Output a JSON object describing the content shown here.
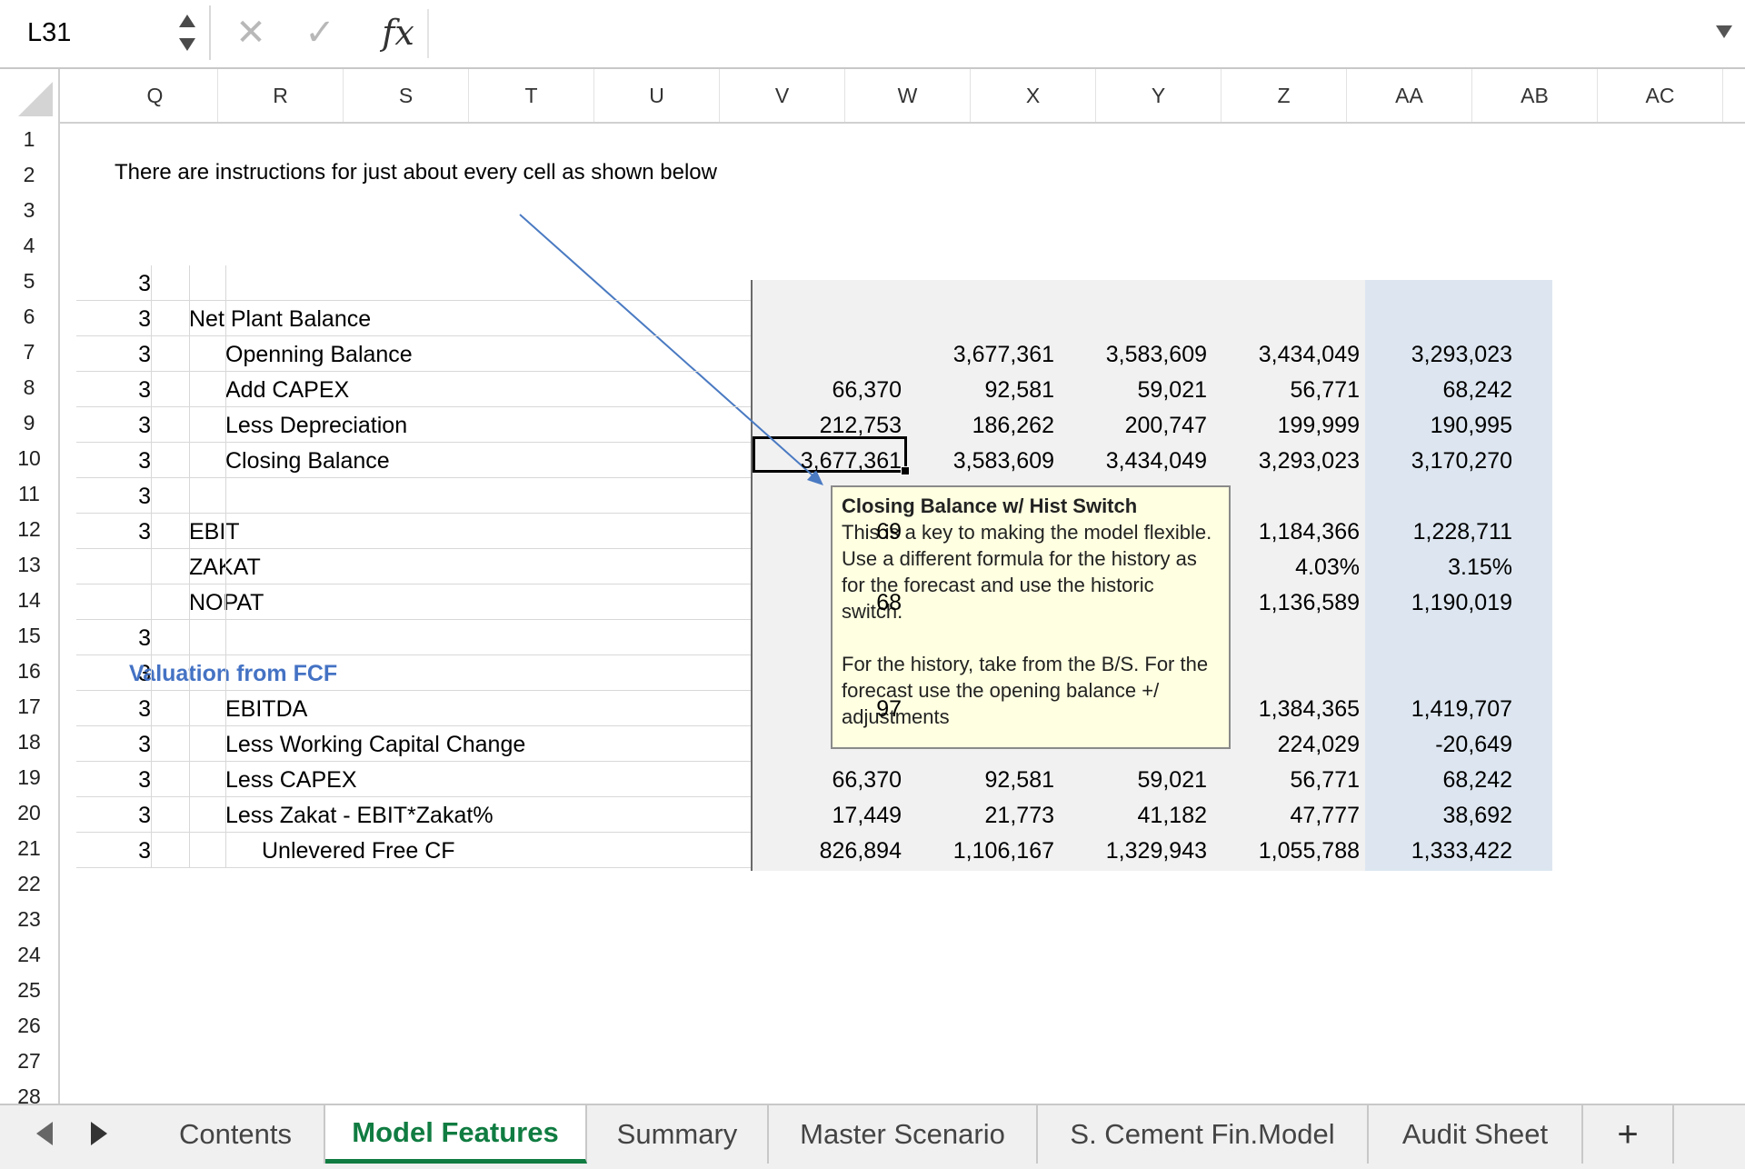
{
  "formula_bar": {
    "name_box": "L31",
    "cancel_glyph": "✕",
    "enter_glyph": "✓",
    "insert_function_glyph": "fx",
    "formula": ""
  },
  "columns": [
    "Q",
    "R",
    "S",
    "T",
    "U",
    "V",
    "W",
    "X",
    "Y",
    "Z",
    "AA",
    "AB",
    "AC"
  ],
  "rows": [
    "1",
    "2",
    "3",
    "4",
    "5",
    "6",
    "7",
    "8",
    "9",
    "10",
    "11",
    "12",
    "13",
    "14",
    "15",
    "16",
    "17",
    "18",
    "19",
    "20",
    "21",
    "22",
    "23",
    "24",
    "25",
    "26",
    "27",
    "28"
  ],
  "note": "There are instructions for just about every cell as shown below",
  "table": {
    "rows": [
      {
        "level": "3",
        "label": "",
        "indent": 0,
        "values": [
          "",
          "",
          "",
          "",
          ""
        ]
      },
      {
        "level": "3",
        "label": "Net Plant Balance",
        "indent": 1,
        "values": [
          "",
          "",
          "",
          "",
          ""
        ]
      },
      {
        "level": "3",
        "label": "Openning Balance",
        "indent": 2,
        "values": [
          "",
          "3,677,361",
          "3,583,609",
          "3,434,049",
          "3,293,023"
        ]
      },
      {
        "level": "3",
        "label": "Add CAPEX",
        "indent": 2,
        "values": [
          "66,370",
          "92,581",
          "59,021",
          "56,771",
          "68,242"
        ]
      },
      {
        "level": "3",
        "label": "Less Depreciation",
        "indent": 2,
        "values": [
          "212,753",
          "186,262",
          "200,747",
          "199,999",
          "190,995"
        ]
      },
      {
        "level": "3",
        "label": "Closing Balance",
        "indent": 2,
        "values": [
          "3,677,361",
          "3,583,609",
          "3,434,049",
          "3,293,023",
          "3,170,270"
        ]
      },
      {
        "level": "3",
        "label": "",
        "indent": 0,
        "values": [
          "",
          "",
          "",
          "",
          ""
        ]
      },
      {
        "level": "3",
        "label": "EBIT",
        "indent": 1,
        "values": [
          "69",
          "",
          "",
          "1,184,366",
          "1,228,711"
        ]
      },
      {
        "level": "",
        "label": "ZAKAT",
        "indent": 1,
        "values": [
          "",
          "",
          "",
          "4.03%",
          "3.15%"
        ]
      },
      {
        "level": "",
        "label": "NOPAT",
        "indent": 1,
        "values": [
          "68",
          "",
          "",
          "1,136,589",
          "1,190,019"
        ]
      },
      {
        "level": "3",
        "label": "",
        "indent": 0,
        "values": [
          "",
          "",
          "",
          "",
          ""
        ]
      },
      {
        "level": "3",
        "label": "Valuation from FCF",
        "indent": 0,
        "values": [
          "",
          "",
          "",
          "",
          ""
        ]
      },
      {
        "level": "3",
        "label": "EBITDA",
        "indent": 2,
        "values": [
          "97",
          "",
          "",
          "1,384,365",
          "1,419,707"
        ]
      },
      {
        "level": "3",
        "label": "Less Working Capital Change",
        "indent": 2,
        "values": [
          "",
          "",
          "",
          "224,029",
          "-20,649"
        ]
      },
      {
        "level": "3",
        "label": "Less CAPEX",
        "indent": 2,
        "values": [
          "66,370",
          "92,581",
          "59,021",
          "56,771",
          "68,242"
        ]
      },
      {
        "level": "3",
        "label": "Less Zakat - EBIT*Zakat%",
        "indent": 2,
        "values": [
          "17,449",
          "21,773",
          "41,182",
          "47,777",
          "38,692"
        ]
      },
      {
        "level": "3",
        "label": "Unlevered Free CF",
        "indent": 3,
        "values": [
          "826,894",
          "1,106,167",
          "1,329,943",
          "1,055,788",
          "1,333,422"
        ]
      }
    ]
  },
  "comment": {
    "title": "Closing Balance w/ Hist Switch",
    "body": "This is a key to making the model flexible.  Use a different formula for the history as for the forecast and use the historic switch.\n\nFor the history, take from the B/S. For the forecast use the opening balance +/ adjustments"
  },
  "tabs": [
    {
      "label": "Contents",
      "active": false
    },
    {
      "label": "Model Features",
      "active": true
    },
    {
      "label": "Summary",
      "active": false
    },
    {
      "label": "Master Scenario",
      "active": false
    },
    {
      "label": "S. Cement Fin.Model",
      "active": false
    },
    {
      "label": "Audit Sheet",
      "active": false
    }
  ],
  "add_tab_glyph": "+",
  "colors": {
    "accent": "#107c41",
    "highlight_col": "#dde6f0",
    "link_blue": "#4472c4",
    "comment_bg": "#ffffe1"
  }
}
